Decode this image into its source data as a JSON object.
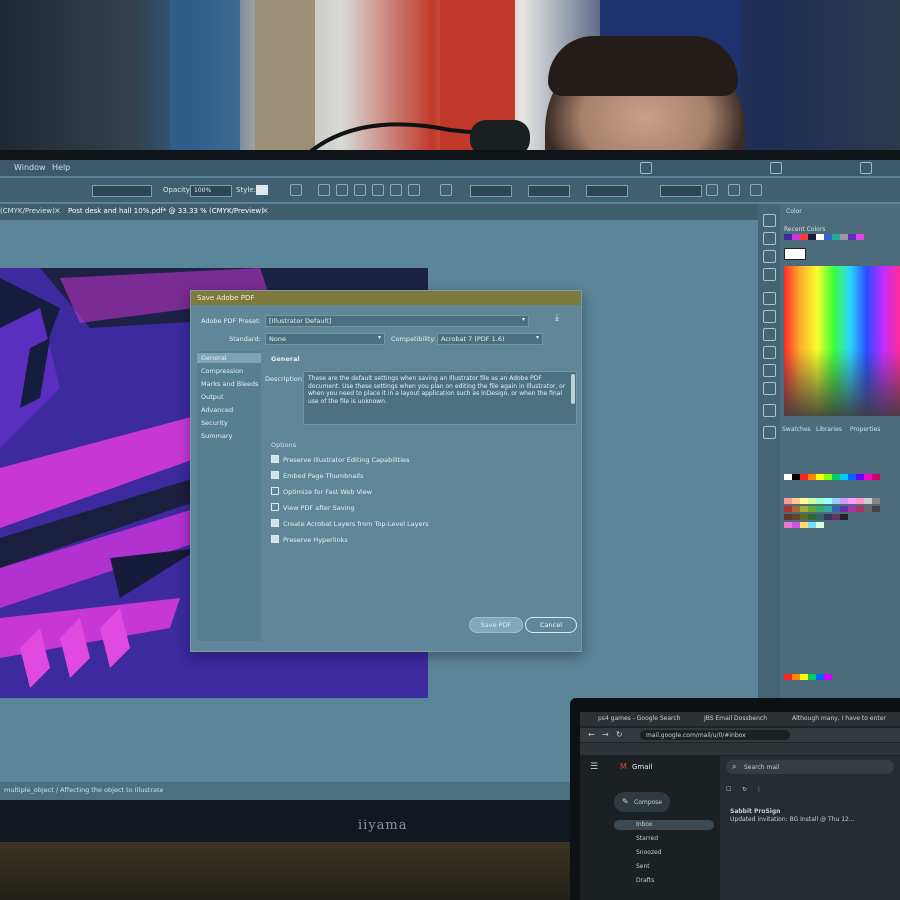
{
  "app": {
    "menu": [
      "Window",
      "Help"
    ],
    "control_bar": {
      "opacity_label": "Opacity:",
      "opacity_value": "100%",
      "style_label": "Style:"
    },
    "document_tabs": [
      "(CMYK/Preview)",
      "Post desk and hall 10%.pdf* @ 33.33 % (CMYK/Preview)"
    ],
    "status_text": "multiple_object  /  Affecting the object to Illustrate",
    "panels": {
      "color_tab": "Color",
      "recent_colors": "Recent Colors",
      "swatches_tab": "Swatches",
      "libraries_tab": "Libraries",
      "properties_tab": "Properties"
    }
  },
  "dialog": {
    "title": "Save Adobe PDF",
    "preset_label": "Adobe PDF Preset:",
    "preset_value": "[Illustrator Default]",
    "standard_label": "Standard:",
    "standard_value": "None",
    "compat_label": "Compatibility:",
    "compat_value": "Acrobat 7 (PDF 1.6)",
    "sections": [
      "General",
      "Compression",
      "Marks and Bleeds",
      "Output",
      "Advanced",
      "Security",
      "Summary"
    ],
    "section_heading": "General",
    "description_label": "Description:",
    "description": "These are the default settings when saving an Illustrator file as an Adobe PDF document. Use these settings when you plan on editing the file again in Illustrator, or when you need to place it in a layout application such as InDesign, or when the final use of the file is unknown.",
    "options_heading": "Options",
    "options": [
      {
        "label": "Preserve Illustrator Editing Capabilities",
        "checked": true
      },
      {
        "label": "Embed Page Thumbnails",
        "checked": true
      },
      {
        "label": "Optimize for Fast Web View",
        "checked": false
      },
      {
        "label": "View PDF after Saving",
        "checked": false
      },
      {
        "label": "Create Acrobat Layers from Top-Level Layers",
        "checked": true
      },
      {
        "label": "Preserve Hyperlinks",
        "checked": true
      }
    ],
    "save_button": "Save PDF",
    "cancel_button": "Cancel"
  },
  "monitor_brand": "iiyama",
  "laptop": {
    "tabs": [
      "ps4 games - Google Search",
      "JBS Email Dossbench",
      "Although many, I have to enter"
    ],
    "url": "mail.google.com/mail/u/0/#inbox",
    "app_name": "Gmail",
    "search_placeholder": "Search mail",
    "compose": "Compose",
    "nav": [
      "Inbox",
      "Starred",
      "Snoozed",
      "Sent",
      "Drafts"
    ],
    "email_sender": "Sabbit ProSign",
    "email_subject": "Updated invitation: BG Install @ Thu 12..."
  },
  "colors": {
    "artwork_purple": "#3c2a9e",
    "artwork_magenta": "#c637d6",
    "dialog_title": "#7e7a3c",
    "screen_bg": "#5b8598"
  }
}
